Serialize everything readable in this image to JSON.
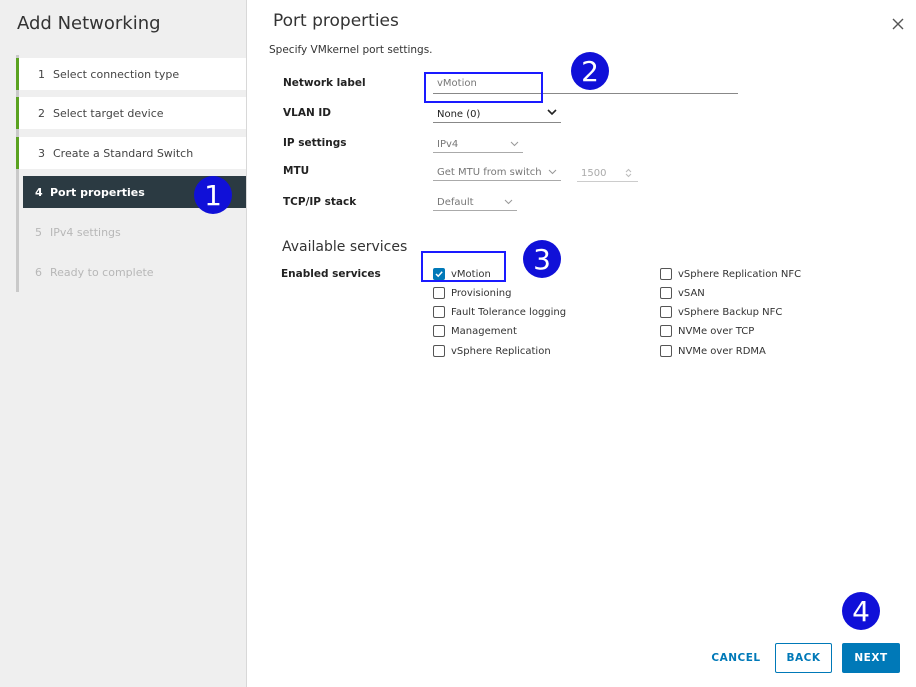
{
  "sidebar": {
    "title": "Add Networking",
    "steps": [
      {
        "num": "1",
        "label": "Select connection type"
      },
      {
        "num": "2",
        "label": "Select target device"
      },
      {
        "num": "3",
        "label": "Create a Standard Switch"
      },
      {
        "num": "4",
        "label": "Port properties"
      },
      {
        "num": "5",
        "label": "IPv4 settings"
      },
      {
        "num": "6",
        "label": "Ready to complete"
      }
    ]
  },
  "main": {
    "title": "Port properties",
    "subtitle": "Specify VMkernel port settings.",
    "fields": {
      "network_label": {
        "label": "Network label",
        "value": "vMotion"
      },
      "vlan_id": {
        "label": "VLAN ID",
        "value": "None (0)"
      },
      "ip_settings": {
        "label": "IP settings",
        "value": "IPv4"
      },
      "mtu": {
        "label": "MTU",
        "value": "Get MTU from switch",
        "number": "1500"
      },
      "tcpip_stack": {
        "label": "TCP/IP stack",
        "value": "Default"
      }
    },
    "services_title": "Available services",
    "enabled_label": "Enabled services",
    "services_left": [
      {
        "label": "vMotion",
        "checked": true
      },
      {
        "label": "Provisioning",
        "checked": false
      },
      {
        "label": "Fault Tolerance logging",
        "checked": false
      },
      {
        "label": "Management",
        "checked": false
      },
      {
        "label": "vSphere Replication",
        "checked": false
      }
    ],
    "services_right": [
      {
        "label": "vSphere Replication NFC",
        "checked": false
      },
      {
        "label": "vSAN",
        "checked": false
      },
      {
        "label": "vSphere Backup NFC",
        "checked": false
      },
      {
        "label": "NVMe over TCP",
        "checked": false
      },
      {
        "label": "NVMe over RDMA",
        "checked": false
      }
    ]
  },
  "footer": {
    "cancel": "CANCEL",
    "back": "BACK",
    "next": "NEXT"
  },
  "annotations": [
    "1",
    "2",
    "3",
    "4"
  ],
  "colors": {
    "accent": "#0079b8",
    "active_step_bg": "#2b3a42",
    "done_step_bar": "#5aa220",
    "annotation_blue": "#1010d8"
  }
}
